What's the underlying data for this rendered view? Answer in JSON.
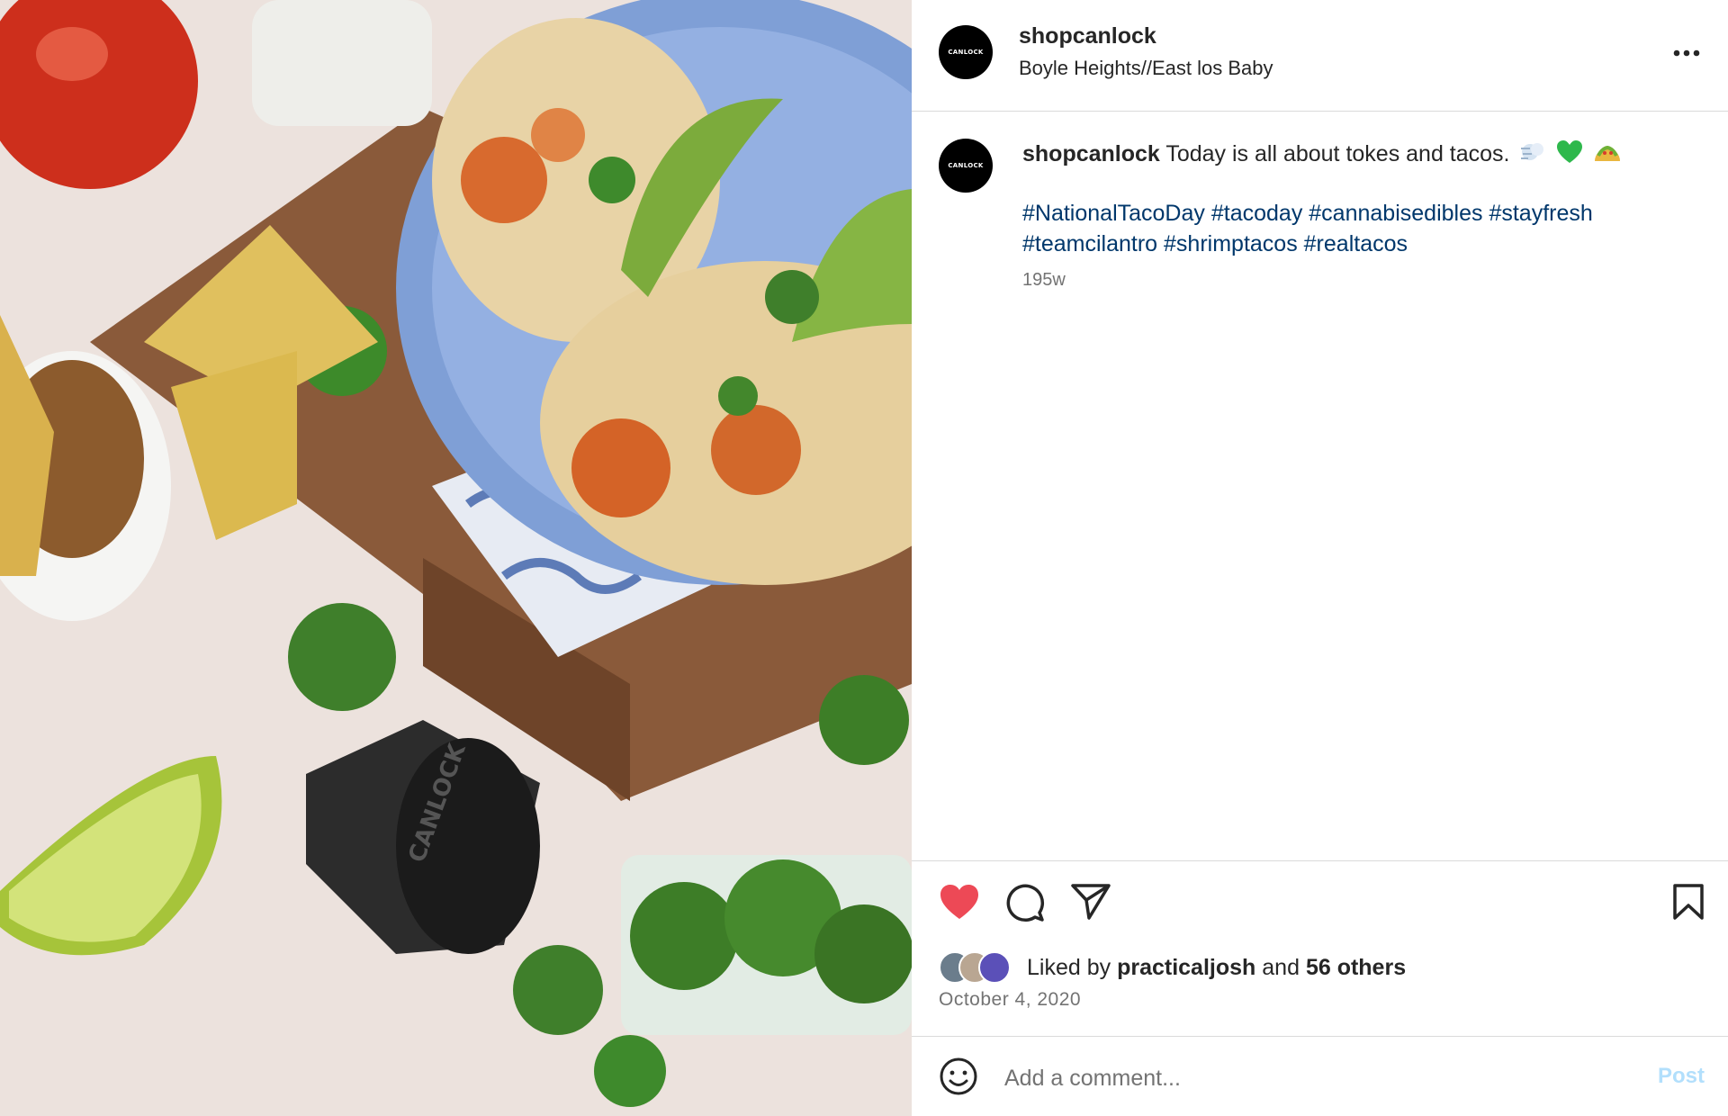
{
  "post": {
    "photo_alt": "",
    "header": {
      "username": "shopcanlock",
      "location": "Boyle Heights//East los Baby",
      "avatar_text": "CANLOCK",
      "more_icon": "more-horizontal-icon"
    },
    "caption": {
      "username": "shopcanlock",
      "text": "Today is all about tokes and tacos.",
      "emojis": [
        "dash-icon",
        "green-heart-icon",
        "taco-icon"
      ],
      "hashtags": [
        "#NationalTacoDay",
        "#tacoday",
        "#cannabisedibles",
        "#stayfresh",
        "#teamcilantro",
        "#shrimptacos",
        "#realtacos"
      ],
      "age": "195w"
    },
    "actions": {
      "like_icon": "heart-filled-icon",
      "comment_icon": "comment-icon",
      "share_icon": "share-icon",
      "save_icon": "bookmark-icon",
      "like_color": "#ed4956"
    },
    "likes": {
      "prefix": "Liked by",
      "user": "practicaljosh",
      "and": "and",
      "others": "56 others"
    },
    "date": "October 4, 2020",
    "comment": {
      "placeholder": "Add a comment...",
      "post_label": "Post",
      "emoji_icon": "smiley-icon"
    }
  }
}
